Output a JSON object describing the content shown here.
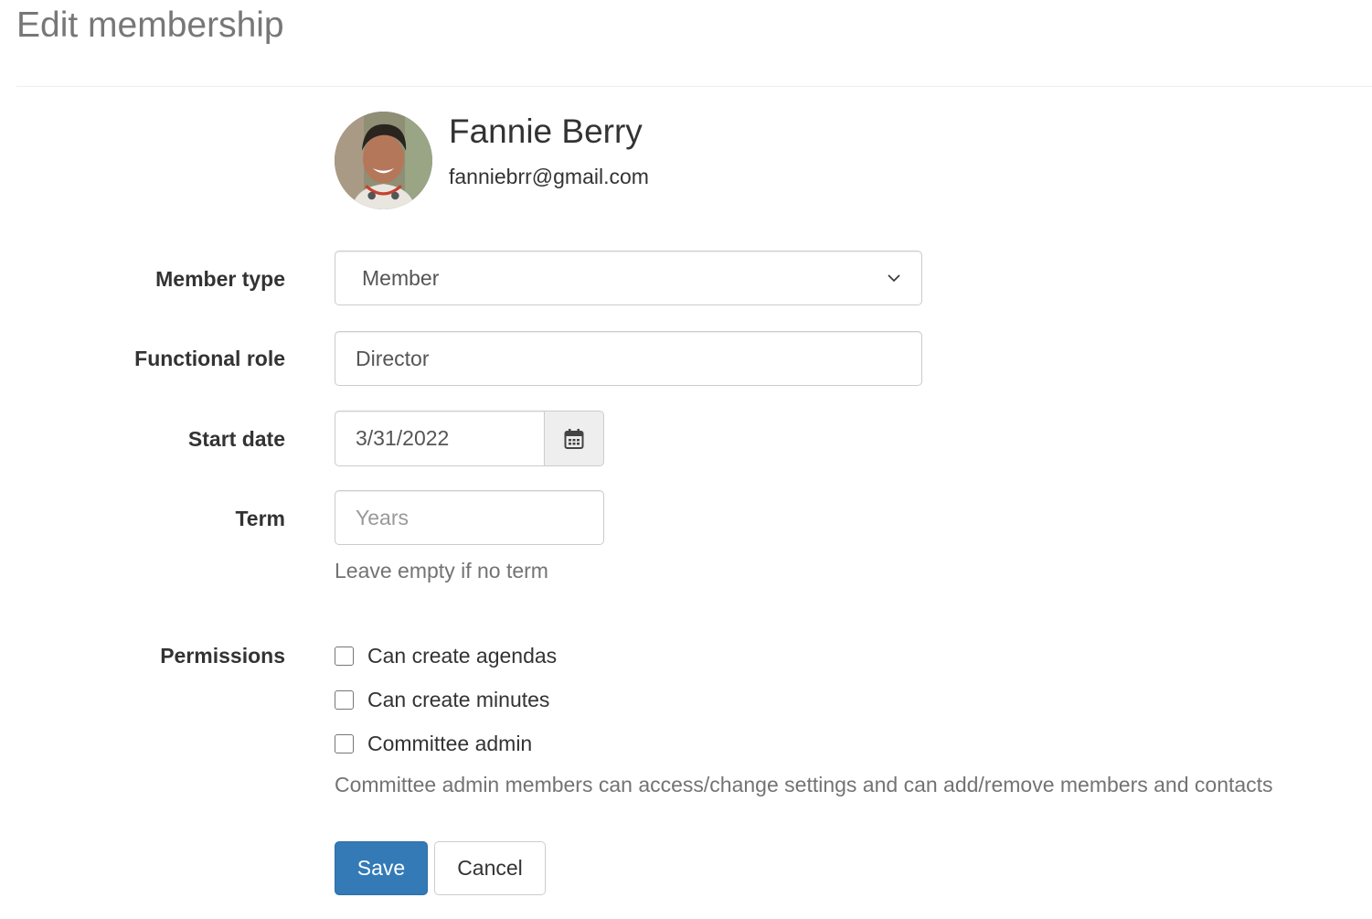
{
  "header": {
    "title": "Edit membership"
  },
  "member": {
    "name": "Fannie Berry",
    "email": "fanniebrr@gmail.com",
    "avatar_icon": "avatar-photo"
  },
  "form": {
    "member_type": {
      "label": "Member type",
      "selected": "Member",
      "icon": "chevron-down-icon"
    },
    "functional_role": {
      "label": "Functional role",
      "value": "Director"
    },
    "start_date": {
      "label": "Start date",
      "value": "3/31/2022",
      "icon": "calendar-icon"
    },
    "term": {
      "label": "Term",
      "value": "",
      "placeholder": "Years",
      "help": "Leave empty if no term"
    },
    "permissions": {
      "label": "Permissions",
      "options": [
        {
          "label": "Can create agendas",
          "checked": false
        },
        {
          "label": "Can create minutes",
          "checked": false
        },
        {
          "label": "Committee admin",
          "checked": false
        }
      ],
      "help": "Committee admin members can access/change settings and can add/remove members and contacts"
    }
  },
  "actions": {
    "save_label": "Save",
    "cancel_label": "Cancel"
  },
  "colors": {
    "primary": "#337ab7",
    "title": "#777777",
    "help": "#737373"
  }
}
